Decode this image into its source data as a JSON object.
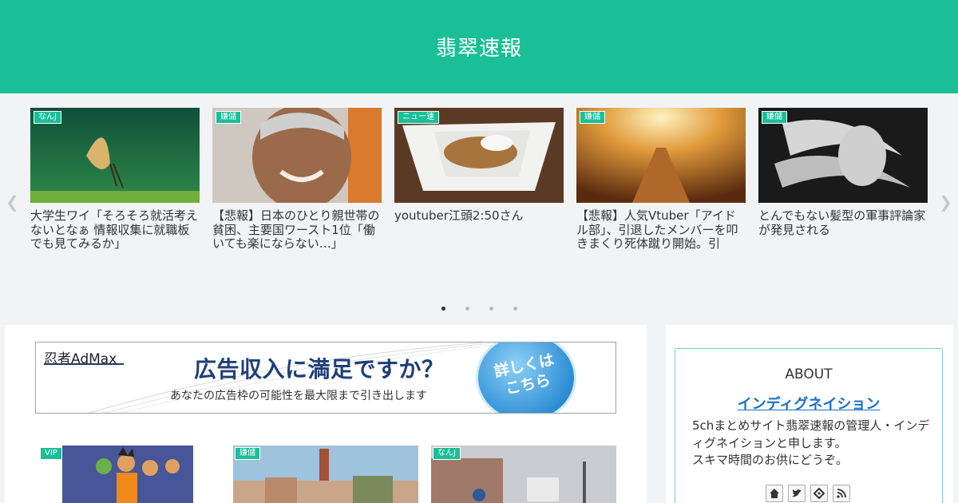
{
  "site": {
    "title": "翡翠速報"
  },
  "carousel": {
    "items": [
      {
        "category": "なんJ",
        "title": "大学生ワイ「そろそろ就活考えないとなぁ 情報収集に就職板でも見てみるか」"
      },
      {
        "category": "嫌儲",
        "title": "【悲報】日本のひとり親世帯の貧困、主要国ワースト1位「働いても楽にならない…」"
      },
      {
        "category": "ニュー速",
        "title": "youtuber江頭2:50さん"
      },
      {
        "category": "嫌儲",
        "title": "【悲報】人気Vtuber「アイドル部」、引退したメンバーを叩きまくり死体蹴り開始。引"
      },
      {
        "category": "嫌儲",
        "title": "とんでもない髪型の軍事評論家が発見される"
      }
    ],
    "prev_icon": "chevron-left-icon",
    "next_icon": "chevron-right-icon",
    "pages": 4,
    "active_page": 1
  },
  "ad": {
    "logo": "忍者AdMax",
    "headline": "広告収入に満足ですか？",
    "subtext": "あなたの広告枠の可能性を最大限まで引き出します",
    "button": "詳しくは\nこちら"
  },
  "posts": [
    {
      "category": "VIP"
    },
    {
      "category": "嫌儲"
    },
    {
      "category": "なんJ"
    }
  ],
  "sidebar": {
    "about_title": "ABOUT",
    "author_name": "インディグネイション",
    "description": "5chまとめサイト翡翠速報の管理人・インディグネイションと申します。\nスキマ時間のお供にどうぞ。",
    "social_icons": [
      "home-icon",
      "twitter-icon",
      "feedly-icon",
      "rss-icon"
    ]
  },
  "colors": {
    "accent": "#1abf97",
    "link": "#1a6fc9",
    "border": "#7ec6cf"
  }
}
